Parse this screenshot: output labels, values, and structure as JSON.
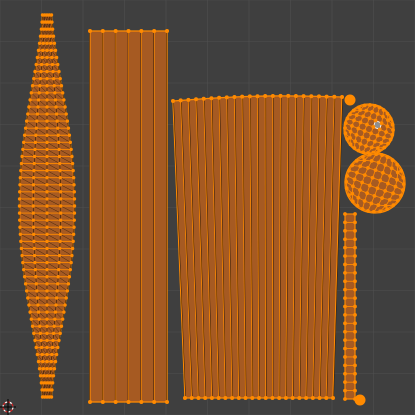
{
  "editor": {
    "name": "UV Editor",
    "background_color": "#3f3f3f",
    "grid_color": "#505050",
    "selection_color": "#ff8a00",
    "face_fill_color": "#a65a22",
    "edge_color": "#2a1707",
    "active_face_color": "#8f8f8f"
  },
  "islands": [
    {
      "name": "vertical-spindle-island",
      "selected": true
    },
    {
      "name": "tall-strip-island",
      "selected": true
    },
    {
      "name": "wide-strips-island",
      "selected": true
    },
    {
      "name": "sphere-island-top",
      "selected": true
    },
    {
      "name": "sphere-island-bottom",
      "selected": true
    },
    {
      "name": "narrow-column-island",
      "selected": true
    }
  ],
  "cursor": {
    "name": "2d-cursor"
  }
}
